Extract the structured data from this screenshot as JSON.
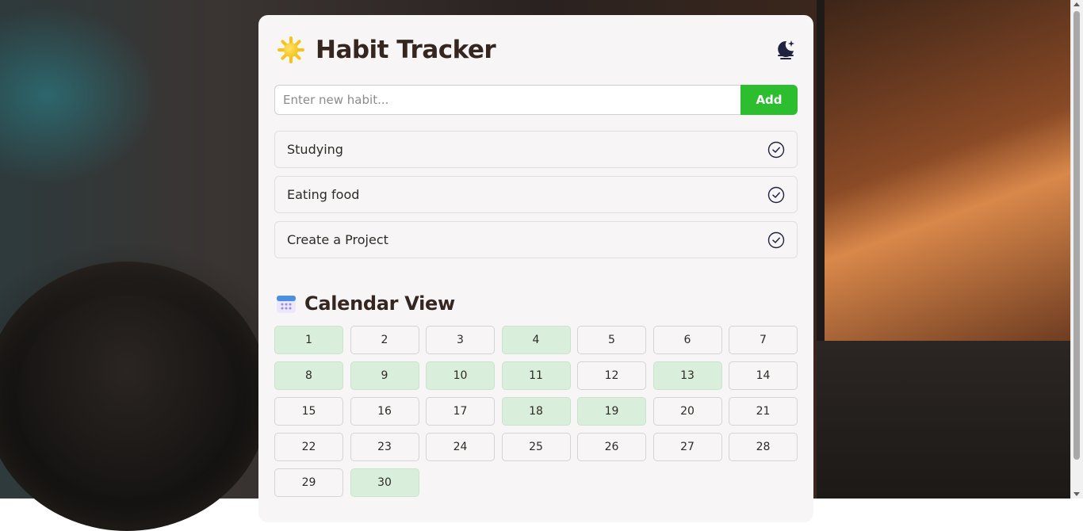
{
  "app": {
    "title": "Habit Tracker",
    "icon": "sun-icon",
    "theme_toggle_icon": "moon-stars-icon"
  },
  "new_habit": {
    "placeholder": "Enter new habit...",
    "value": "",
    "add_label": "Add"
  },
  "habits": [
    {
      "label": "Studying",
      "icon": "check-circle-icon"
    },
    {
      "label": "Eating food",
      "icon": "check-circle-icon"
    },
    {
      "label": "Create a Project",
      "icon": "check-circle-icon"
    }
  ],
  "calendar": {
    "title": "Calendar View",
    "icon": "calendar-icon",
    "days": [
      {
        "day": "1",
        "done": true
      },
      {
        "day": "2",
        "done": false
      },
      {
        "day": "3",
        "done": false
      },
      {
        "day": "4",
        "done": true
      },
      {
        "day": "5",
        "done": false
      },
      {
        "day": "6",
        "done": false
      },
      {
        "day": "7",
        "done": false
      },
      {
        "day": "8",
        "done": true
      },
      {
        "day": "9",
        "done": true
      },
      {
        "day": "10",
        "done": true
      },
      {
        "day": "11",
        "done": true
      },
      {
        "day": "12",
        "done": false
      },
      {
        "day": "13",
        "done": true
      },
      {
        "day": "14",
        "done": false
      },
      {
        "day": "15",
        "done": false
      },
      {
        "day": "16",
        "done": false
      },
      {
        "day": "17",
        "done": false
      },
      {
        "day": "18",
        "done": true
      },
      {
        "day": "19",
        "done": true
      },
      {
        "day": "20",
        "done": false
      },
      {
        "day": "21",
        "done": false
      },
      {
        "day": "22",
        "done": false
      },
      {
        "day": "23",
        "done": false
      },
      {
        "day": "24",
        "done": false
      },
      {
        "day": "25",
        "done": false
      },
      {
        "day": "26",
        "done": false
      },
      {
        "day": "27",
        "done": false
      },
      {
        "day": "28",
        "done": false
      },
      {
        "day": "29",
        "done": false
      },
      {
        "day": "30",
        "done": true
      }
    ]
  },
  "colors": {
    "accent_green": "#2cbe2f",
    "done_day_bg": "#d9efdb",
    "title_text": "#35261f",
    "card_bg": "#f7f5f5"
  }
}
